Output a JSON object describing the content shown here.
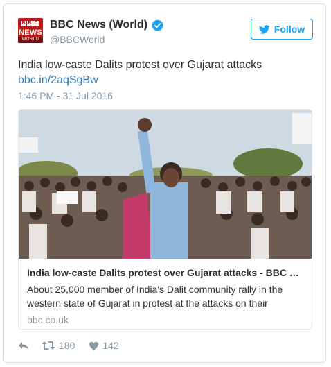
{
  "account": {
    "display_name": "BBC News (World)",
    "handle": "@BBCWorld",
    "avatar_logo_letters": [
      "B",
      "B",
      "C"
    ],
    "avatar_news": "NEWS",
    "avatar_world": "WORLD",
    "verified_icon": "verified-badge-icon"
  },
  "follow_button": {
    "label": "Follow",
    "icon": "bird-icon"
  },
  "tweet": {
    "text": "India low-caste Dalits protest over Gujarat attacks",
    "link": "bbc.in/2aqSgBw",
    "timestamp": "1:46 PM - 31 Jul 2016"
  },
  "card": {
    "image_alt": "photo-of-protest-crowd",
    "title": "India low-caste Dalits protest over Gujarat attacks - BBC News",
    "description": "About 25,000 member of India's Dalit community rally in the western state of Gujarat in protest at the attacks on their",
    "domain": "bbc.co.uk"
  },
  "actions": {
    "reply_icon": "reply-icon",
    "retweet_icon": "retweet-icon",
    "retweet_count": "180",
    "like_icon": "heart-icon",
    "like_count": "142"
  },
  "colors": {
    "accent": "#1da1f2",
    "link": "#2b7bb9",
    "muted": "#8899a6",
    "bbc_red": "#bb1919"
  }
}
